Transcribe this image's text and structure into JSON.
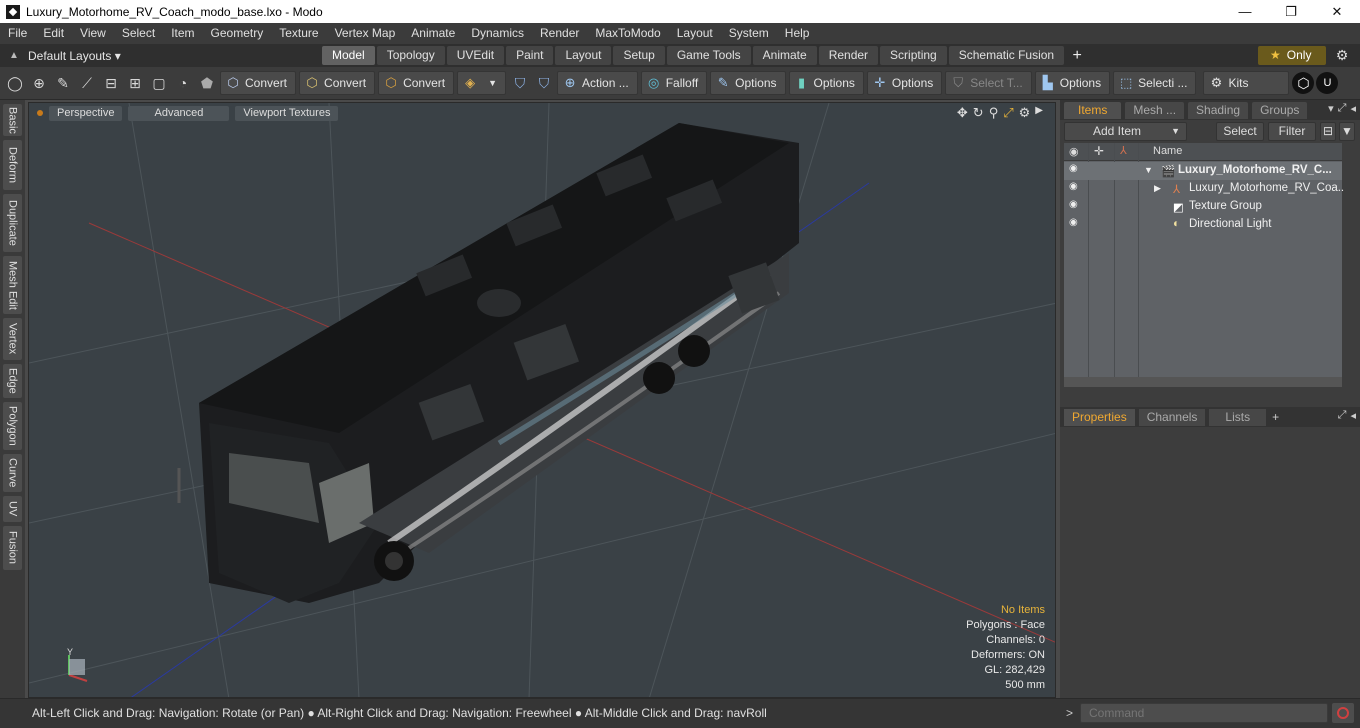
{
  "window": {
    "title": "Luxury_Motorhome_RV_Coach_modo_base.lxo - Modo",
    "minimize": "—",
    "maximize": "❐",
    "close": "✕"
  },
  "menu": [
    "File",
    "Edit",
    "View",
    "Select",
    "Item",
    "Geometry",
    "Texture",
    "Vertex Map",
    "Animate",
    "Dynamics",
    "Render",
    "MaxToModo",
    "Layout",
    "System",
    "Help"
  ],
  "layouts": {
    "default_label": "Default Layouts ▾",
    "tabs": [
      "Model",
      "Topology",
      "UVEdit",
      "Paint",
      "Layout",
      "Setup",
      "Game Tools",
      "Animate",
      "Render",
      "Scripting",
      "Schematic Fusion"
    ],
    "active_tab": "Model",
    "only_label": "Only",
    "star": "★"
  },
  "toolbar": {
    "buttons": [
      {
        "label": "Convert",
        "icon": "cube-convert-icon"
      },
      {
        "label": "Convert",
        "icon": "cube-convert-icon"
      },
      {
        "label": "Convert",
        "icon": "cube-convert-icon"
      },
      {
        "label": "Action ...",
        "icon": "action-center-icon"
      },
      {
        "label": "Falloff",
        "icon": "falloff-icon"
      },
      {
        "label": "Options",
        "icon": "options-icon"
      },
      {
        "label": "Options",
        "icon": "options-icon"
      },
      {
        "label": "Options",
        "icon": "options-icon"
      },
      {
        "label": "Select T...",
        "icon": "select-tool-icon"
      },
      {
        "label": "Options",
        "icon": "options-icon"
      },
      {
        "label": "Selecti ...",
        "icon": "selection-icon"
      },
      {
        "label": "Kits",
        "icon": "kits-icon"
      }
    ]
  },
  "left_tabs": [
    "Basic",
    "Deform",
    "Duplicate",
    "Mesh Edit",
    "Vertex",
    "Edge",
    "Polygon",
    "Curve",
    "UV",
    "Fusion"
  ],
  "viewport": {
    "buttons": [
      "Perspective",
      "Advanced",
      "Viewport Textures"
    ],
    "stats": {
      "no_items": "No Items",
      "polygons": "Polygons : Face",
      "channels": "Channels: 0",
      "deformers": "Deformers: ON",
      "gl": "GL: 282,429",
      "scale": "500 mm"
    },
    "axis": {
      "y": "Y",
      "x": "X"
    }
  },
  "items_panel": {
    "tabs": [
      "Items",
      "Mesh ...",
      "Shading",
      "Groups"
    ],
    "active_tab": "Items",
    "add_item": "Add Item",
    "select": "Select",
    "filter": "Filter",
    "name_header": "Name",
    "rows": [
      {
        "label": "Luxury_Motorhome_RV_C...",
        "bold": true
      },
      {
        "label": "Luxury_Motorhome_RV_Coa...",
        "bold": false
      },
      {
        "label": "Texture Group",
        "bold": false
      },
      {
        "label": "Directional Light",
        "bold": false
      }
    ]
  },
  "properties_panel": {
    "tabs": [
      "Properties",
      "Channels",
      "Lists"
    ],
    "active_tab": "Properties",
    "plus": "+"
  },
  "statusbar": {
    "hint": "Alt-Left Click and Drag: Navigation: Rotate (or Pan) ● Alt-Right Click and Drag: Navigation: Freewheel ● Alt-Middle Click and Drag: navRoll",
    "command_placeholder": "Command",
    "arrow": ">"
  }
}
